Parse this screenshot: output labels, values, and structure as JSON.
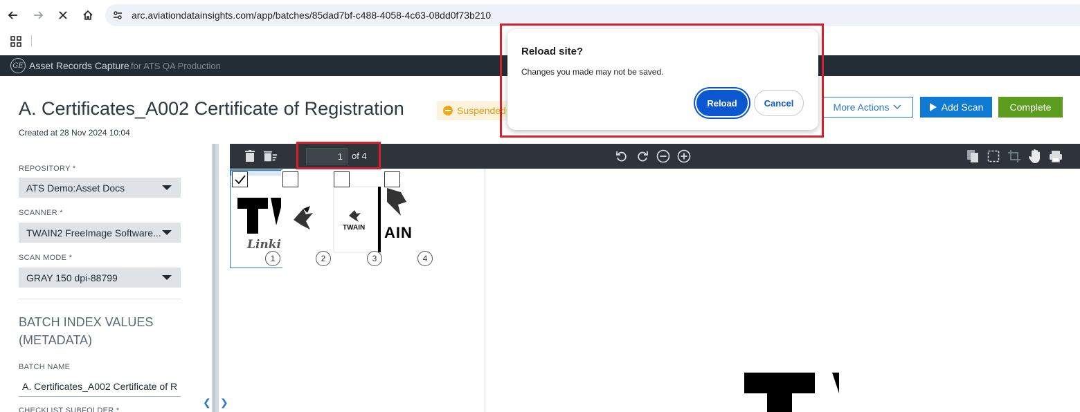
{
  "browser": {
    "url": "arc.aviationdatainsights.com/app/batches/85dad7bf-c488-4058-4c63-08dd0f73b210"
  },
  "app": {
    "logo_text": "GE",
    "name": "Asset Records Capture",
    "context": "for ATS QA Production"
  },
  "batch": {
    "title": "A. Certificates_A002 Certificate of Registration",
    "created": "Created at 28 Nov 2024 10:04",
    "status": "Suspended",
    "status_color": "#f0a81b"
  },
  "actions": {
    "more_actions": "More Actions",
    "add_scan": "Add Scan",
    "complete": "Complete"
  },
  "settings": {
    "repository_label": "REPOSITORY *",
    "repository_value": "ATS Demo:Asset Docs",
    "scanner_label": "SCANNER *",
    "scanner_value": "TWAIN2 FreeImage Software...",
    "scan_mode_label": "SCAN MODE *",
    "scan_mode_value": "GRAY 150 dpi-88799",
    "section_title": "BATCH INDEX VALUES (METADATA)",
    "batch_name_label": "BATCH NAME",
    "batch_name_value": "A. Certificates_A002 Certificate of R",
    "checklist_label": "CHECKLIST SUBFOLDER *"
  },
  "viewer": {
    "current_page": "1",
    "page_total": "of 4",
    "thumbnails": [
      {
        "number": "1",
        "checked": true,
        "caption": "Linkin"
      },
      {
        "number": "2",
        "checked": false,
        "caption": ""
      },
      {
        "number": "3",
        "checked": false,
        "caption": "TWAIN"
      },
      {
        "number": "4",
        "checked": false,
        "caption": "AIN"
      }
    ]
  },
  "dialog": {
    "title": "Reload site?",
    "message": "Changes you made may not be saved.",
    "reload": "Reload",
    "cancel": "Cancel"
  },
  "colors": {
    "primary": "#0f7ad1",
    "complete": "#5c9c1e",
    "highlight": "#d7202a",
    "dialog_accent": "#0b57d0"
  }
}
